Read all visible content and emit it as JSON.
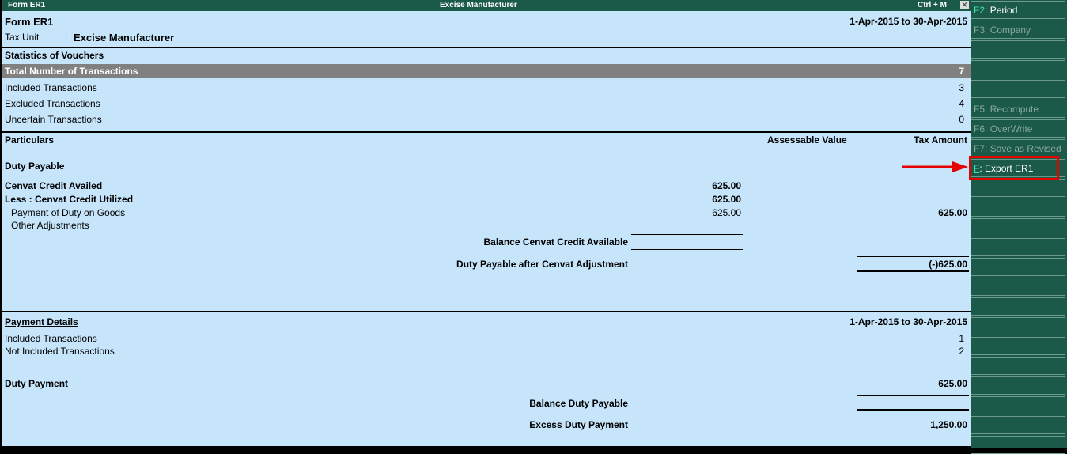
{
  "window": {
    "title_left": "Form ER1",
    "title_center": "Excise Manufacturer",
    "shortcut": "Ctrl + M",
    "close": "✕"
  },
  "header": {
    "form": "Form ER1",
    "period": "1-Apr-2015 to 30-Apr-2015",
    "tax_unit_label": "Tax Unit",
    "sep": ":",
    "tax_unit": "Excise Manufacturer"
  },
  "stats": {
    "title": "Statistics of Vouchers",
    "rows": [
      {
        "label": "Total Number of Transactions",
        "value": "7"
      },
      {
        "label": "Included Transactions",
        "value": "3"
      },
      {
        "label": "Excluded Transactions",
        "value": "4"
      },
      {
        "label": "Uncertain Transactions",
        "value": "0"
      }
    ]
  },
  "columns": {
    "particulars": "Particulars",
    "assessable": "Assessable Value",
    "tax": "Tax Amount"
  },
  "duty": {
    "title": "Duty Payable",
    "cenvat_availed": "Cenvat Credit Availed",
    "cenvat_availed_val": "625.00",
    "less_utilized": "Less : Cenvat Credit Utilized",
    "less_utilized_val": "625.00",
    "payment_goods": "Payment of Duty on Goods",
    "payment_goods_val": "625.00",
    "payment_goods_tax": "625.00",
    "other_adj": "Other Adjustments",
    "balance_cenvat": "Balance Cenvat Credit Available",
    "duty_after": "Duty Payable after Cenvat Adjustment",
    "duty_after_val": "(-)625.00"
  },
  "payment": {
    "title": "Payment Details",
    "period": "1-Apr-2015 to 30-Apr-2015",
    "included": "Included Transactions",
    "included_val": "1",
    "not_included": "Not Included Transactions",
    "not_included_val": "2",
    "duty_payment": "Duty Payment",
    "duty_payment_val": "625.00",
    "balance_duty": "Balance Duty Payable",
    "excess": "Excess Duty Payment",
    "excess_val": "1,250.00"
  },
  "side": [
    {
      "key": "F2",
      "label": "Period",
      "enabled": true
    },
    {
      "key": "F3",
      "label": "Company",
      "enabled": false
    },
    {
      "key": "",
      "label": ""
    },
    {
      "key": "",
      "label": ""
    },
    {
      "key": "",
      "label": ""
    },
    {
      "key": "F5",
      "label": "Recompute",
      "enabled": false
    },
    {
      "key": "F6",
      "label": "OverWrite",
      "enabled": false
    },
    {
      "key": "F7",
      "label": "Save as Revised",
      "enabled": false
    },
    {
      "key": "F",
      "label": "Export ER1",
      "enabled": true
    }
  ]
}
